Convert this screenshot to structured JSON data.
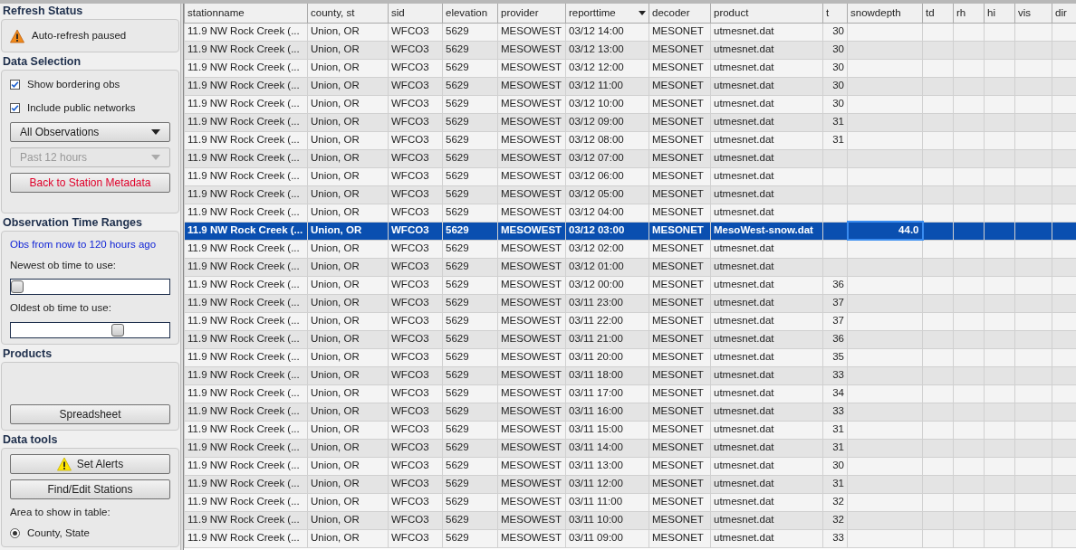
{
  "sidebar": {
    "sections": [
      {
        "title": "Refresh Status",
        "items": [
          {
            "kind": "status",
            "text": "Auto-refresh paused"
          }
        ]
      },
      {
        "title": "Data Selection",
        "items": [
          {
            "kind": "checkbox",
            "label": "Show bordering obs",
            "checked": true
          },
          {
            "kind": "checkbox",
            "label": "Include public networks",
            "checked": true
          },
          {
            "kind": "dropdown",
            "label": "All Observations",
            "disabled": false
          },
          {
            "kind": "dropdown",
            "label": "Past 12 hours",
            "disabled": true
          },
          {
            "kind": "alert_button",
            "label": "Back to Station Metadata"
          }
        ]
      },
      {
        "title": "Observation Time Ranges",
        "items": [
          {
            "kind": "note",
            "text": "Obs from now to 120 hours ago"
          },
          {
            "kind": "label",
            "text": "Newest ob time to use:"
          },
          {
            "kind": "slider",
            "level": 0
          },
          {
            "kind": "label",
            "text": "Oldest ob time to use:"
          },
          {
            "kind": "slider",
            "level": 0.7
          }
        ]
      },
      {
        "title": "Products",
        "items": [
          {
            "kind": "spacer"
          },
          {
            "kind": "button",
            "label": "Spreadsheet"
          }
        ]
      },
      {
        "title": "Data tools",
        "items": [
          {
            "kind": "warning_button",
            "label": "Set Alerts"
          },
          {
            "kind": "button",
            "label": "Find/Edit Stations"
          },
          {
            "kind": "label",
            "text": "Area to show in table:"
          },
          {
            "kind": "radio",
            "label": "County, State",
            "selected": true
          }
        ]
      }
    ]
  },
  "table": {
    "columns": [
      {
        "label": "stationname",
        "sorted": false
      },
      {
        "label": "county, st",
        "sorted": false
      },
      {
        "label": "sid",
        "sorted": false
      },
      {
        "label": "elevation",
        "sorted": false
      },
      {
        "label": "provider",
        "sorted": false
      },
      {
        "label": "reporttime",
        "sorted": true
      },
      {
        "label": "decoder",
        "sorted": false
      },
      {
        "label": "product",
        "sorted": false
      },
      {
        "label": "t",
        "sorted": false
      },
      {
        "label": "snowdepth",
        "sorted": false
      },
      {
        "label": "td",
        "sorted": false
      },
      {
        "label": "rh",
        "sorted": false
      },
      {
        "label": "hi",
        "sorted": false
      },
      {
        "label": "vis",
        "sorted": false
      },
      {
        "label": "dir",
        "sorted": false
      }
    ],
    "rows": [
      {
        "selected": false,
        "cells": [
          "11.9 NW Rock Creek (...",
          "Union, OR",
          "WFCO3",
          "5629",
          "MESOWEST",
          "03/12 14:00",
          "MESONET",
          "utmesnet.dat"
        ],
        "t": "30"
      },
      {
        "selected": false,
        "cells": [
          "11.9 NW Rock Creek (...",
          "Union, OR",
          "WFCO3",
          "5629",
          "MESOWEST",
          "03/12 13:00",
          "MESONET",
          "utmesnet.dat"
        ],
        "t": "30"
      },
      {
        "selected": false,
        "cells": [
          "11.9 NW Rock Creek (...",
          "Union, OR",
          "WFCO3",
          "5629",
          "MESOWEST",
          "03/12 12:00",
          "MESONET",
          "utmesnet.dat"
        ],
        "t": "30"
      },
      {
        "selected": false,
        "cells": [
          "11.9 NW Rock Creek (...",
          "Union, OR",
          "WFCO3",
          "5629",
          "MESOWEST",
          "03/12 11:00",
          "MESONET",
          "utmesnet.dat"
        ],
        "t": "30"
      },
      {
        "selected": false,
        "cells": [
          "11.9 NW Rock Creek (...",
          "Union, OR",
          "WFCO3",
          "5629",
          "MESOWEST",
          "03/12 10:00",
          "MESONET",
          "utmesnet.dat"
        ],
        "t": "30"
      },
      {
        "selected": false,
        "cells": [
          "11.9 NW Rock Creek (...",
          "Union, OR",
          "WFCO3",
          "5629",
          "MESOWEST",
          "03/12 09:00",
          "MESONET",
          "utmesnet.dat"
        ],
        "t": "31"
      },
      {
        "selected": false,
        "cells": [
          "11.9 NW Rock Creek (...",
          "Union, OR",
          "WFCO3",
          "5629",
          "MESOWEST",
          "03/12 08:00",
          "MESONET",
          "utmesnet.dat"
        ],
        "t": "31"
      },
      {
        "selected": false,
        "cells": [
          "11.9 NW Rock Creek (...",
          "Union, OR",
          "WFCO3",
          "5629",
          "MESOWEST",
          "03/12 07:00",
          "MESONET",
          "utmesnet.dat"
        ]
      },
      {
        "selected": false,
        "cells": [
          "11.9 NW Rock Creek (...",
          "Union, OR",
          "WFCO3",
          "5629",
          "MESOWEST",
          "03/12 06:00",
          "MESONET",
          "utmesnet.dat"
        ]
      },
      {
        "selected": false,
        "cells": [
          "11.9 NW Rock Creek (...",
          "Union, OR",
          "WFCO3",
          "5629",
          "MESOWEST",
          "03/12 05:00",
          "MESONET",
          "utmesnet.dat"
        ]
      },
      {
        "selected": false,
        "cells": [
          "11.9 NW Rock Creek (...",
          "Union, OR",
          "WFCO3",
          "5629",
          "MESOWEST",
          "03/12 04:00",
          "MESONET",
          "utmesnet.dat"
        ]
      },
      {
        "selected": true,
        "cells": [
          "11.9 NW Rock Creek (...",
          "Union, OR",
          "WFCO3",
          "5629",
          "MESOWEST",
          "03/12 03:00",
          "MESONET",
          "MesoWest-snow.dat"
        ],
        "snowdepth": "44.0"
      },
      {
        "selected": false,
        "cells": [
          "11.9 NW Rock Creek (...",
          "Union, OR",
          "WFCO3",
          "5629",
          "MESOWEST",
          "03/12 02:00",
          "MESONET",
          "utmesnet.dat"
        ]
      },
      {
        "selected": false,
        "cells": [
          "11.9 NW Rock Creek (...",
          "Union, OR",
          "WFCO3",
          "5629",
          "MESOWEST",
          "03/12 01:00",
          "MESONET",
          "utmesnet.dat"
        ]
      },
      {
        "selected": false,
        "cells": [
          "11.9 NW Rock Creek (...",
          "Union, OR",
          "WFCO3",
          "5629",
          "MESOWEST",
          "03/12 00:00",
          "MESONET",
          "utmesnet.dat"
        ],
        "t": "36"
      },
      {
        "selected": false,
        "cells": [
          "11.9 NW Rock Creek (...",
          "Union, OR",
          "WFCO3",
          "5629",
          "MESOWEST",
          "03/11 23:00",
          "MESONET",
          "utmesnet.dat"
        ],
        "t": "37"
      },
      {
        "selected": false,
        "cells": [
          "11.9 NW Rock Creek (...",
          "Union, OR",
          "WFCO3",
          "5629",
          "MESOWEST",
          "03/11 22:00",
          "MESONET",
          "utmesnet.dat"
        ],
        "t": "37"
      },
      {
        "selected": false,
        "cells": [
          "11.9 NW Rock Creek (...",
          "Union, OR",
          "WFCO3",
          "5629",
          "MESOWEST",
          "03/11 21:00",
          "MESONET",
          "utmesnet.dat"
        ],
        "t": "36"
      },
      {
        "selected": false,
        "cells": [
          "11.9 NW Rock Creek (...",
          "Union, OR",
          "WFCO3",
          "5629",
          "MESOWEST",
          "03/11 20:00",
          "MESONET",
          "utmesnet.dat"
        ],
        "t": "35"
      },
      {
        "selected": false,
        "cells": [
          "11.9 NW Rock Creek (...",
          "Union, OR",
          "WFCO3",
          "5629",
          "MESOWEST",
          "03/11 18:00",
          "MESONET",
          "utmesnet.dat"
        ],
        "t": "33"
      },
      {
        "selected": false,
        "cells": [
          "11.9 NW Rock Creek (...",
          "Union, OR",
          "WFCO3",
          "5629",
          "MESOWEST",
          "03/11 17:00",
          "MESONET",
          "utmesnet.dat"
        ],
        "t": "34"
      },
      {
        "selected": false,
        "cells": [
          "11.9 NW Rock Creek (...",
          "Union, OR",
          "WFCO3",
          "5629",
          "MESOWEST",
          "03/11 16:00",
          "MESONET",
          "utmesnet.dat"
        ],
        "t": "33"
      },
      {
        "selected": false,
        "cells": [
          "11.9 NW Rock Creek (...",
          "Union, OR",
          "WFCO3",
          "5629",
          "MESOWEST",
          "03/11 15:00",
          "MESONET",
          "utmesnet.dat"
        ],
        "t": "31"
      },
      {
        "selected": false,
        "cells": [
          "11.9 NW Rock Creek (...",
          "Union, OR",
          "WFCO3",
          "5629",
          "MESOWEST",
          "03/11 14:00",
          "MESONET",
          "utmesnet.dat"
        ],
        "t": "31"
      },
      {
        "selected": false,
        "cells": [
          "11.9 NW Rock Creek (...",
          "Union, OR",
          "WFCO3",
          "5629",
          "MESOWEST",
          "03/11 13:00",
          "MESONET",
          "utmesnet.dat"
        ],
        "t": "30"
      },
      {
        "selected": false,
        "cells": [
          "11.9 NW Rock Creek (...",
          "Union, OR",
          "WFCO3",
          "5629",
          "MESOWEST",
          "03/11 12:00",
          "MESONET",
          "utmesnet.dat"
        ],
        "t": "31"
      },
      {
        "selected": false,
        "cells": [
          "11.9 NW Rock Creek (...",
          "Union, OR",
          "WFCO3",
          "5629",
          "MESOWEST",
          "03/11 11:00",
          "MESONET",
          "utmesnet.dat"
        ],
        "t": "32"
      },
      {
        "selected": false,
        "cells": [
          "11.9 NW Rock Creek (...",
          "Union, OR",
          "WFCO3",
          "5629",
          "MESOWEST",
          "03/11 10:00",
          "MESONET",
          "utmesnet.dat"
        ],
        "t": "32"
      },
      {
        "selected": false,
        "cells": [
          "11.9 NW Rock Creek (...",
          "Union, OR",
          "WFCO3",
          "5629",
          "MESOWEST",
          "03/11 09:00",
          "MESONET",
          "utmesnet.dat"
        ],
        "t": "33"
      }
    ]
  }
}
